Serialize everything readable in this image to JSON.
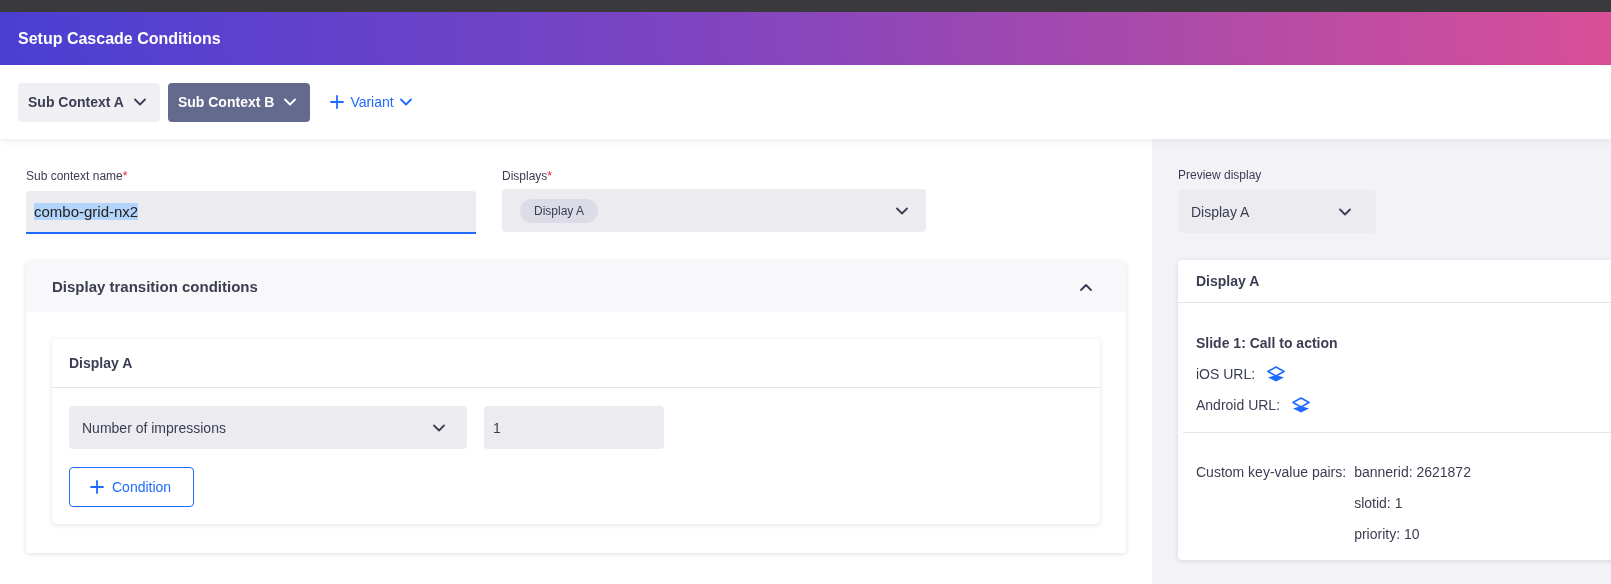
{
  "header": {
    "title": "Setup Cascade Conditions"
  },
  "tabs": [
    {
      "label": "Sub Context A",
      "selected": false
    },
    {
      "label": "Sub Context B",
      "selected": true
    }
  ],
  "add_variant": {
    "label": "Variant"
  },
  "form": {
    "name_field": {
      "label": "Sub context name",
      "required_mark": "*",
      "value": "combo-grid-nx2",
      "text_selected": true
    },
    "displays_field": {
      "label": "Displays",
      "required_mark": "*",
      "chips": [
        "Display A"
      ]
    }
  },
  "transition_panel": {
    "title": "Display transition conditions",
    "expanded": true,
    "cards": [
      {
        "title": "Display A",
        "conditions": [
          {
            "metric": "Number of impressions",
            "value": "1"
          }
        ],
        "add_button": "Condition"
      }
    ]
  },
  "preview": {
    "label": "Preview display",
    "selected_display": "Display A",
    "card": {
      "title": "Display A",
      "slide": "Slide 1: Call to action",
      "links": [
        {
          "label": "iOS URL:"
        },
        {
          "label": "Android URL:"
        }
      ],
      "pairs_label": "Custom key-value pairs:",
      "pairs": [
        "bannerid: 2621872",
        "slotid: 1",
        "priority: 10"
      ]
    }
  }
}
